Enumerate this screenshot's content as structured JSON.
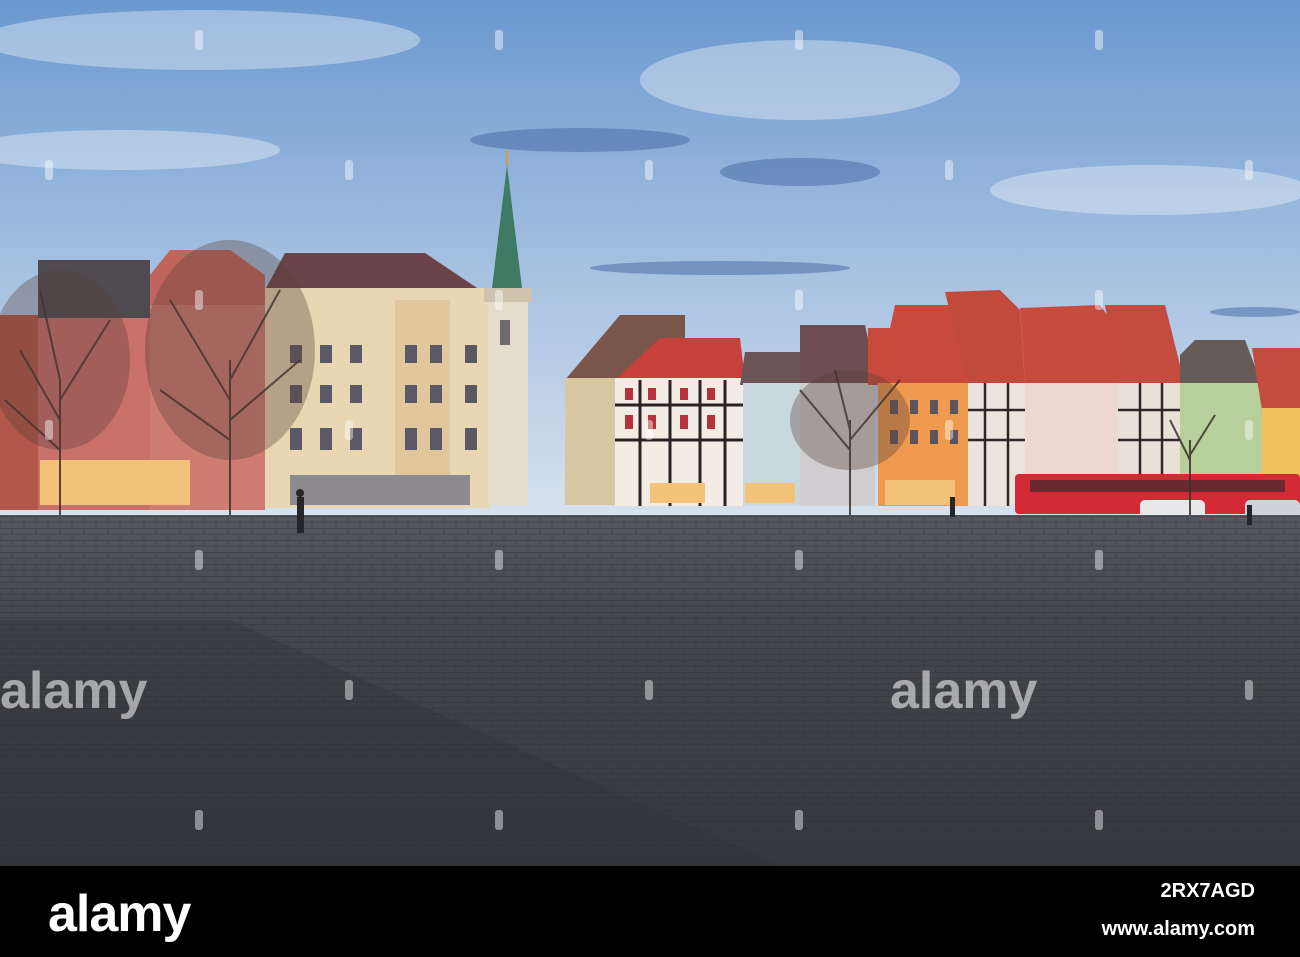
{
  "watermark": {
    "text": "alamy",
    "color": "#ffffff"
  },
  "footer": {
    "brand": "alamy",
    "image_id": "2RX7AGD",
    "site": "www.alamy.com",
    "background": "#000000"
  },
  "scene": {
    "sky_top": "#6b98cf",
    "sky_bottom": "#cfdcec",
    "pavement": "#3d3f45",
    "tram_color": "#d42a35"
  }
}
